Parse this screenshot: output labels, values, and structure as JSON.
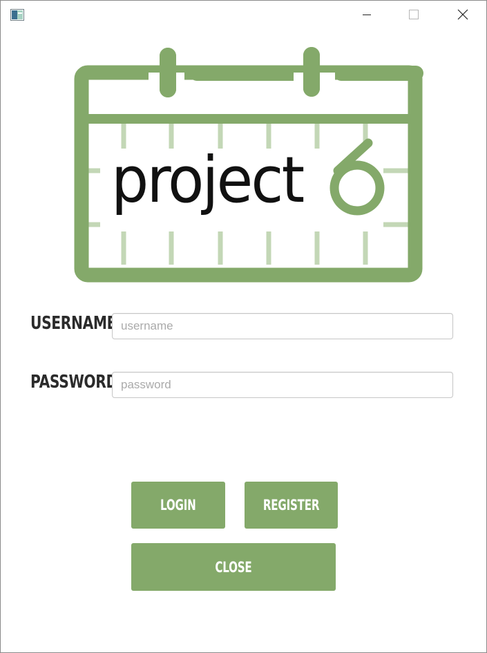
{
  "titlebar": {
    "icons": {
      "app": "app-window-icon",
      "minimize": "minimize-icon",
      "maximize": "maximize-icon",
      "close": "close-icon"
    }
  },
  "logo": {
    "text": "project",
    "digit": "6",
    "colors": {
      "frame": "#84a96a",
      "grid": "#c3d7b6",
      "text": "#111111"
    }
  },
  "form": {
    "username_label": "USERNAME",
    "username_placeholder": "username",
    "username_value": "",
    "password_label": "PASSWORD",
    "password_placeholder": "password",
    "password_value": ""
  },
  "buttons": {
    "login_label": "LOGIN",
    "register_label": "REGISTER",
    "close_label": "CLOSE",
    "color": "#84a96a"
  }
}
